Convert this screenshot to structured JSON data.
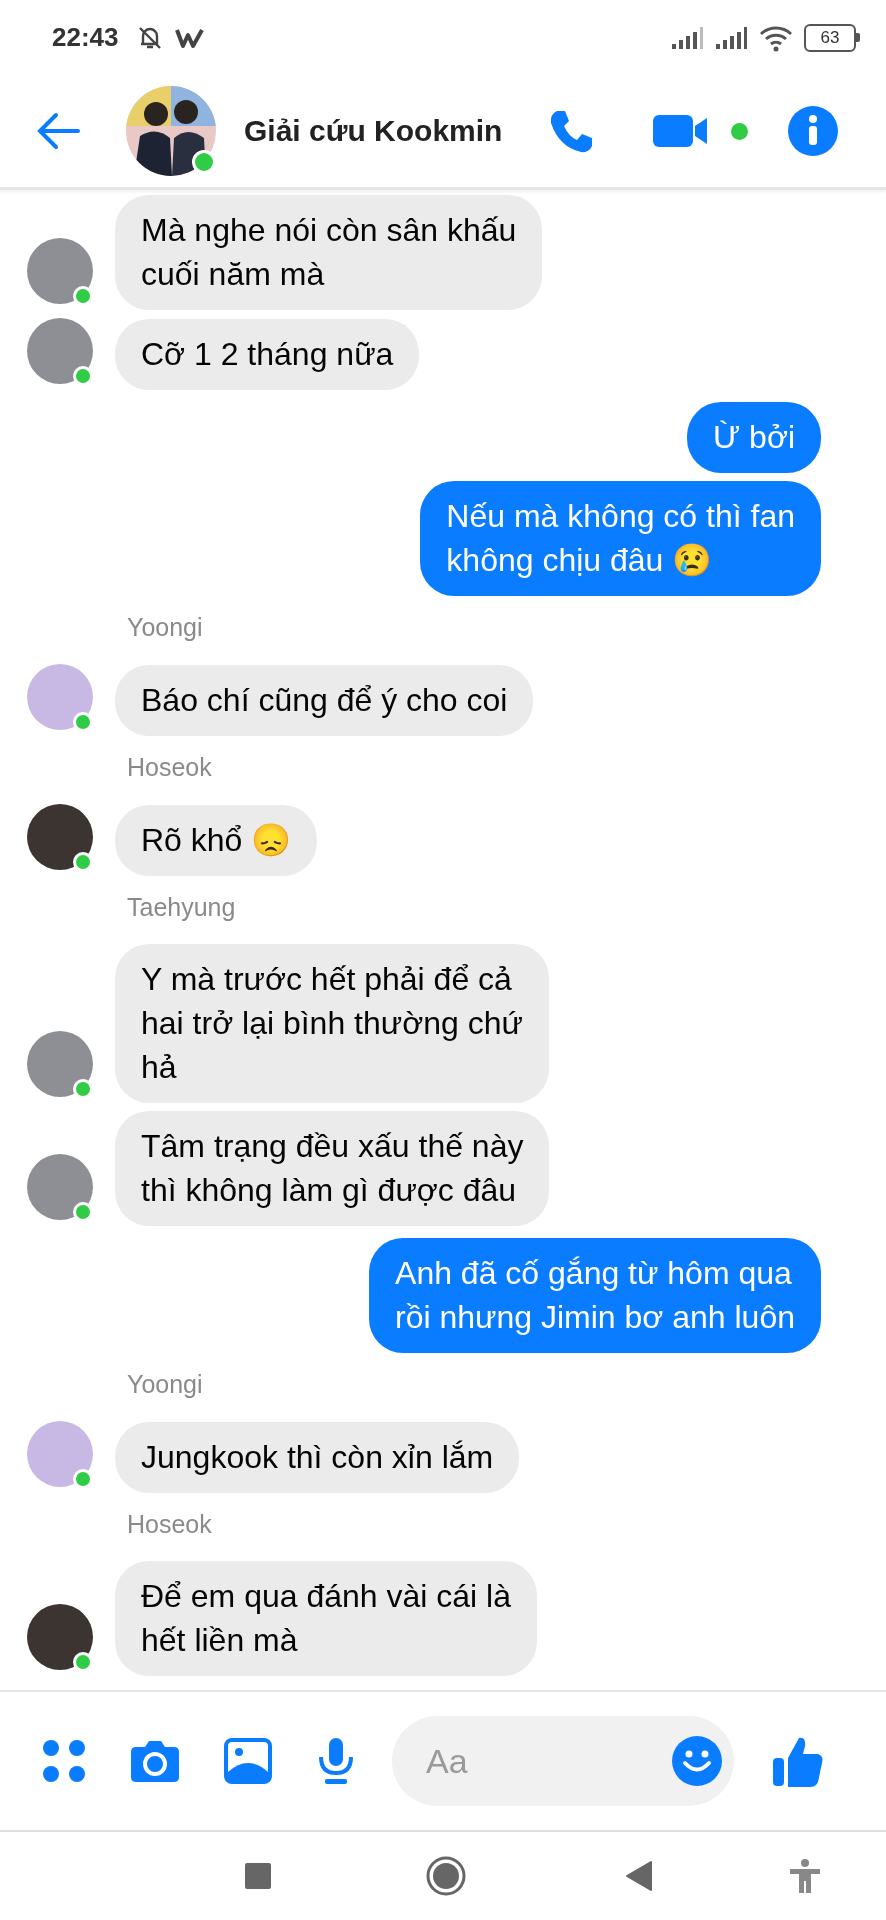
{
  "status_bar": {
    "time": "22:43",
    "battery": "63"
  },
  "header": {
    "title": "Giải cứu Kookmin",
    "online": true
  },
  "messages": [
    {
      "kind": "received",
      "text": "Mà nghe nói còn sân khấu\ncuối năm mà",
      "avatar": {
        "color": "#8d8f94",
        "online": true
      }
    },
    {
      "kind": "received",
      "text": "Cỡ 1 2 tháng nữa",
      "avatar": {
        "color": "#8d8f94",
        "online": true
      }
    },
    {
      "kind": "sent",
      "text": "Ừ bởi"
    },
    {
      "kind": "sent",
      "text": "Nếu mà không có thì fan\nkhông chịu đâu 😢"
    },
    {
      "kind": "sender",
      "text": "Yoongi"
    },
    {
      "kind": "received",
      "text": "Báo chí cũng để ý cho coi",
      "avatar": {
        "color": "#c8b9e4",
        "online": true
      }
    },
    {
      "kind": "sender",
      "text": "Hoseok"
    },
    {
      "kind": "received",
      "text": "Rõ khổ 😞",
      "avatar": {
        "color": "#3b3431",
        "online": true
      }
    },
    {
      "kind": "sender",
      "text": "Taehyung"
    },
    {
      "kind": "received",
      "text": "Y mà trước hết phải để cả\nhai trở lại bình thường chứ\nhả",
      "avatar": {
        "color": "#8d8f94",
        "online": true
      }
    },
    {
      "kind": "received",
      "text": "Tâm trạng đều xấu thế này\nthì không làm gì được đâu",
      "avatar": {
        "color": "#8d8f94",
        "online": true
      }
    },
    {
      "kind": "sent",
      "text": "Anh đã cố gắng từ hôm qua\nrồi nhưng Jimin bơ anh luôn"
    },
    {
      "kind": "sender",
      "text": "Yoongi"
    },
    {
      "kind": "received",
      "text": "Jungkook thì còn xỉn lắm",
      "avatar": {
        "color": "#c8b9e4",
        "online": true
      }
    },
    {
      "kind": "sender",
      "text": "Hoseok"
    },
    {
      "kind": "received",
      "text": "Để em qua đánh vài cái là\nhết liền mà",
      "avatar": {
        "color": "#3b3431",
        "online": true
      }
    }
  ],
  "composer": {
    "placeholder": "Aa"
  }
}
